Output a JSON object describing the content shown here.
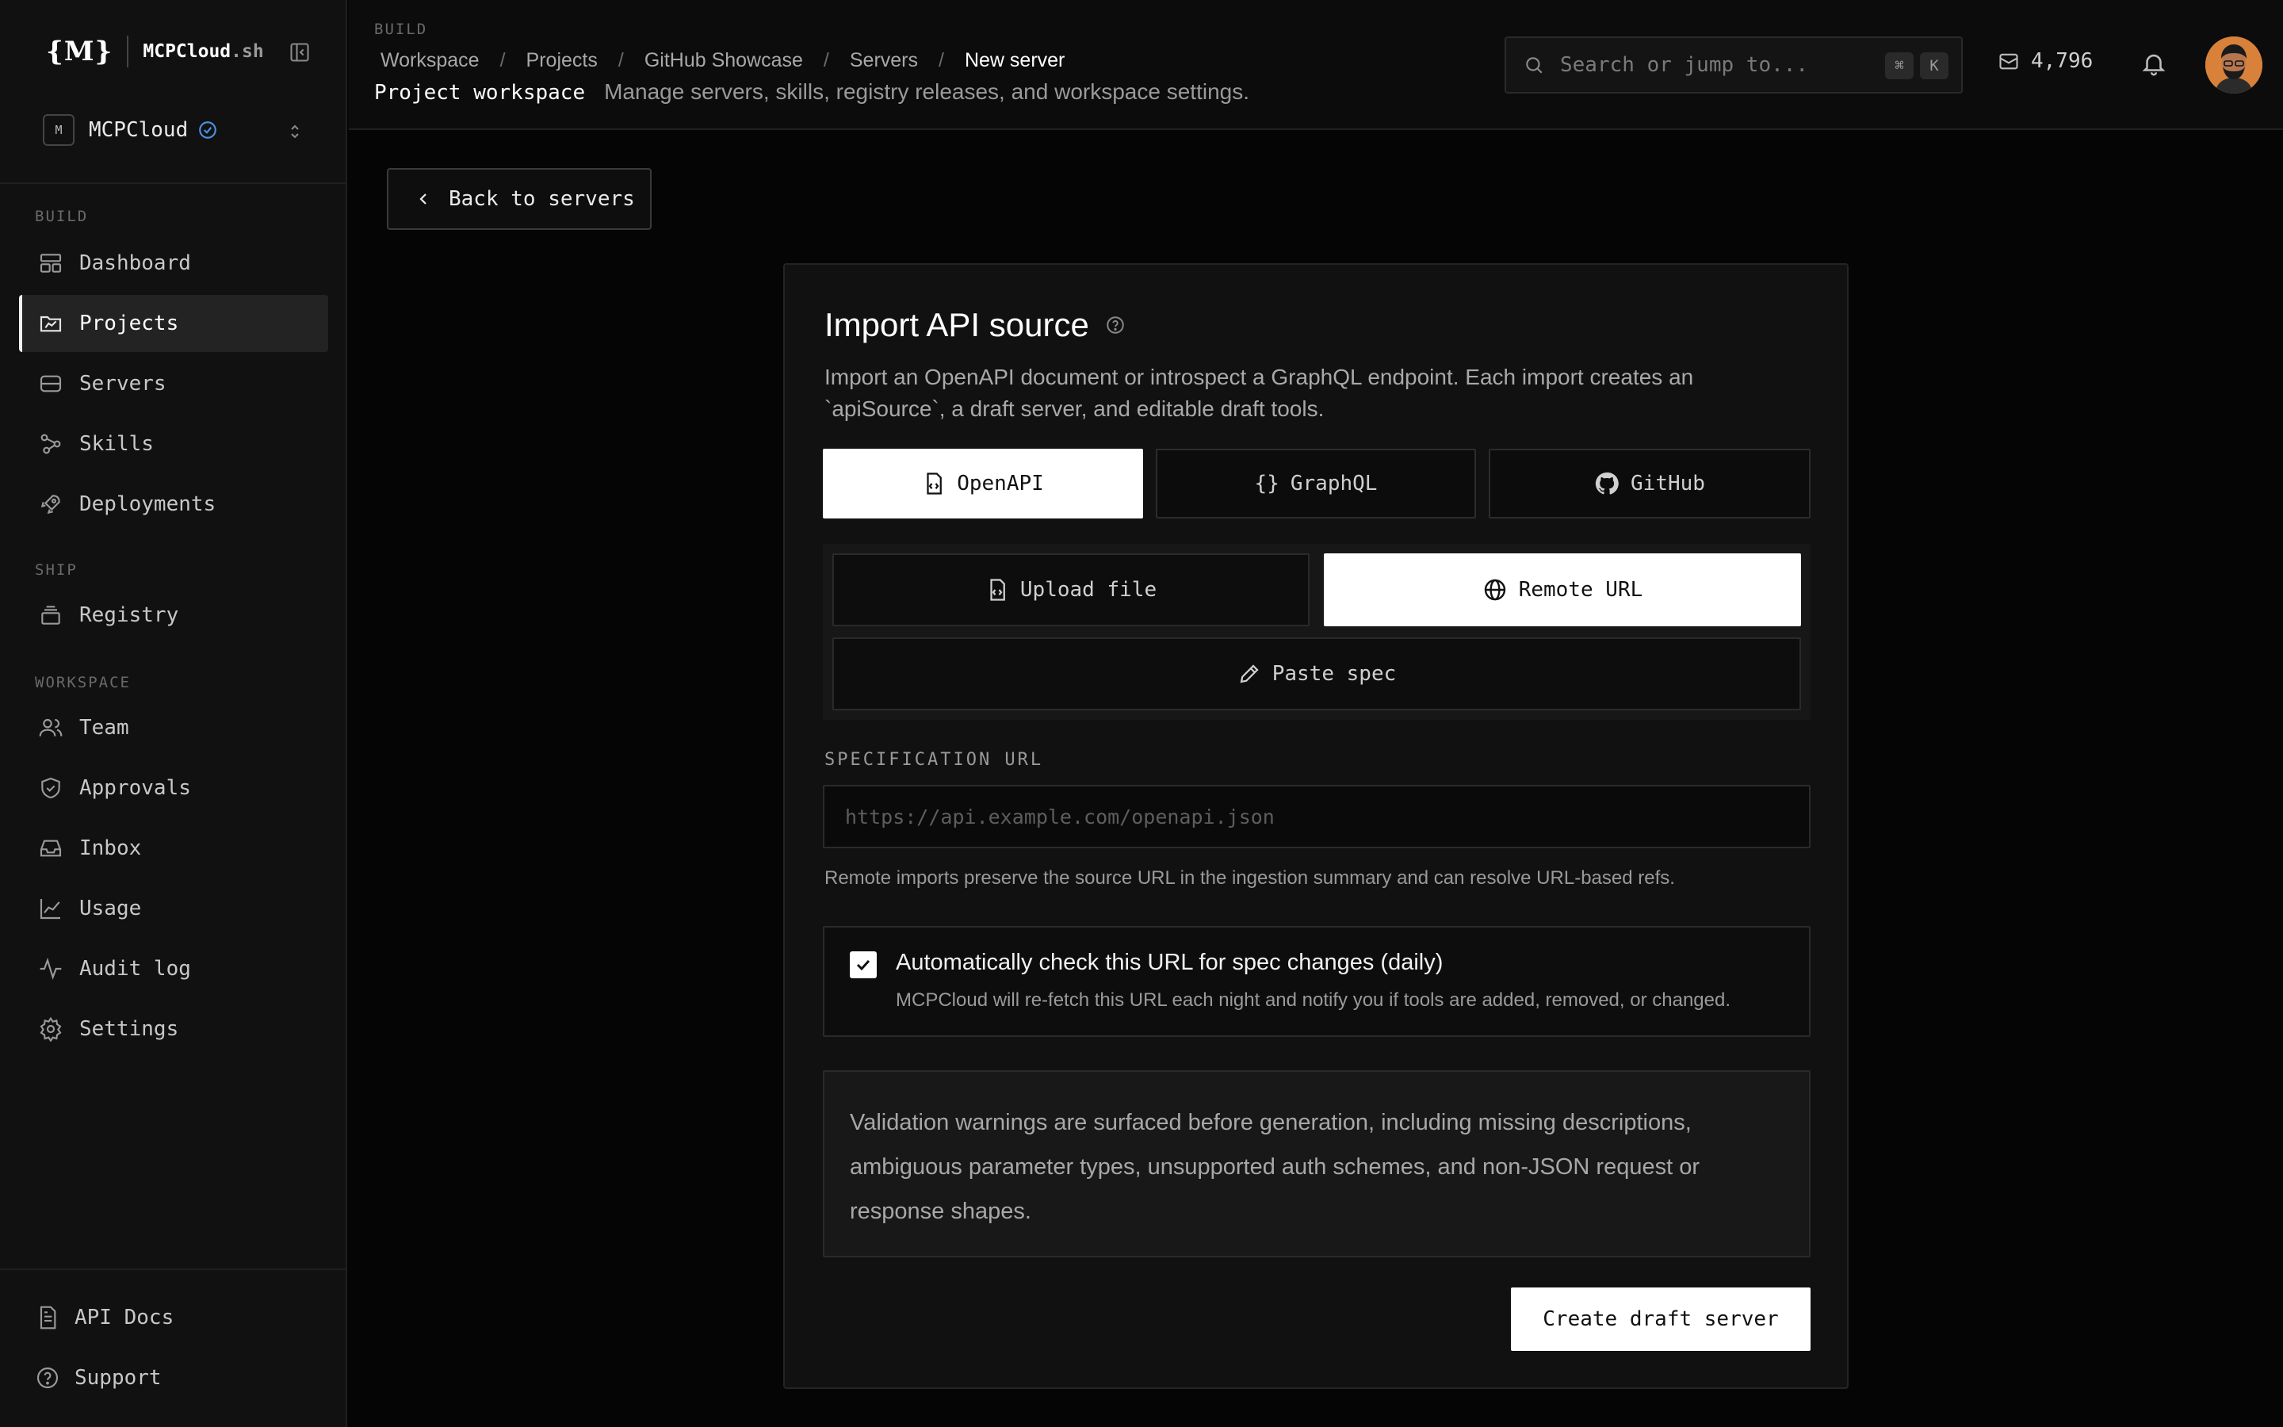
{
  "brand": {
    "mark": "{M}",
    "name": "MCPCloud",
    "name_suffix": ".sh"
  },
  "workspace": {
    "avatar_letter": "M",
    "name": "MCPCloud"
  },
  "sidebar": {
    "sections": [
      {
        "label": "BUILD",
        "items": [
          {
            "label": "Dashboard",
            "icon": "dashboard-icon"
          },
          {
            "label": "Projects",
            "icon": "folder-icon",
            "active": true
          },
          {
            "label": "Servers",
            "icon": "server-icon"
          },
          {
            "label": "Skills",
            "icon": "skills-icon"
          },
          {
            "label": "Deployments",
            "icon": "rocket-icon"
          }
        ]
      },
      {
        "label": "SHIP",
        "items": [
          {
            "label": "Registry",
            "icon": "registry-icon"
          }
        ]
      },
      {
        "label": "WORKSPACE",
        "items": [
          {
            "label": "Team",
            "icon": "team-icon"
          },
          {
            "label": "Approvals",
            "icon": "shield-check-icon"
          },
          {
            "label": "Inbox",
            "icon": "inbox-icon"
          },
          {
            "label": "Usage",
            "icon": "chart-icon"
          },
          {
            "label": "Audit log",
            "icon": "activity-icon"
          },
          {
            "label": "Settings",
            "icon": "gear-icon"
          }
        ]
      }
    ],
    "footer": [
      {
        "label": "API Docs",
        "icon": "doc-icon"
      },
      {
        "label": "Support",
        "icon": "help-icon"
      }
    ]
  },
  "topbar": {
    "section": "BUILD",
    "breadcrumbs": [
      "Workspace",
      "Projects",
      "GitHub Showcase",
      "Servers",
      "New server"
    ],
    "title": "Project workspace",
    "description": "Manage servers, skills, registry releases, and workspace settings.",
    "search_placeholder": "Search or jump to...",
    "shortcut_keys": [
      "⌘",
      "K"
    ],
    "credits": "4,796"
  },
  "main": {
    "back_label": "Back to servers",
    "card": {
      "title": "Import API source",
      "description": "Import an OpenAPI document or introspect a GraphQL endpoint. Each import creates an `apiSource`, a draft server, and editable draft tools.",
      "source_types": [
        {
          "label": "OpenAPI",
          "icon": "file-code-icon",
          "selected": true
        },
        {
          "label": "GraphQL",
          "icon": "braces-icon",
          "selected": false
        },
        {
          "label": "GitHub",
          "icon": "github-icon",
          "selected": false
        }
      ],
      "input_modes": [
        {
          "label": "Upload file",
          "icon": "file-upload-icon",
          "selected": false
        },
        {
          "label": "Remote URL",
          "icon": "globe-icon",
          "selected": true
        },
        {
          "label": "Paste spec",
          "icon": "pencil-icon",
          "selected": false
        }
      ],
      "spec_url_label": "SPECIFICATION URL",
      "spec_url_value": "",
      "spec_url_placeholder": "https://api.example.com/openapi.json",
      "spec_url_hint": "Remote imports preserve the source URL in the ingestion summary and can resolve URL-based refs.",
      "auto_check": {
        "checked": true,
        "title": "Automatically check this URL for spec changes (daily)",
        "subtitle": "MCPCloud will re-fetch this URL each night and notify you if tools are added, removed, or changed."
      },
      "notice": "Validation warnings are surfaced before generation, including missing descriptions, ambiguous parameter types, unsupported auth schemes, and non-JSON request or response shapes.",
      "submit_label": "Create draft server"
    }
  },
  "colors": {
    "background": "#050505",
    "sidebar": "#111111",
    "accent_verified": "#4a90e2",
    "primary_button": "#ffffff"
  }
}
